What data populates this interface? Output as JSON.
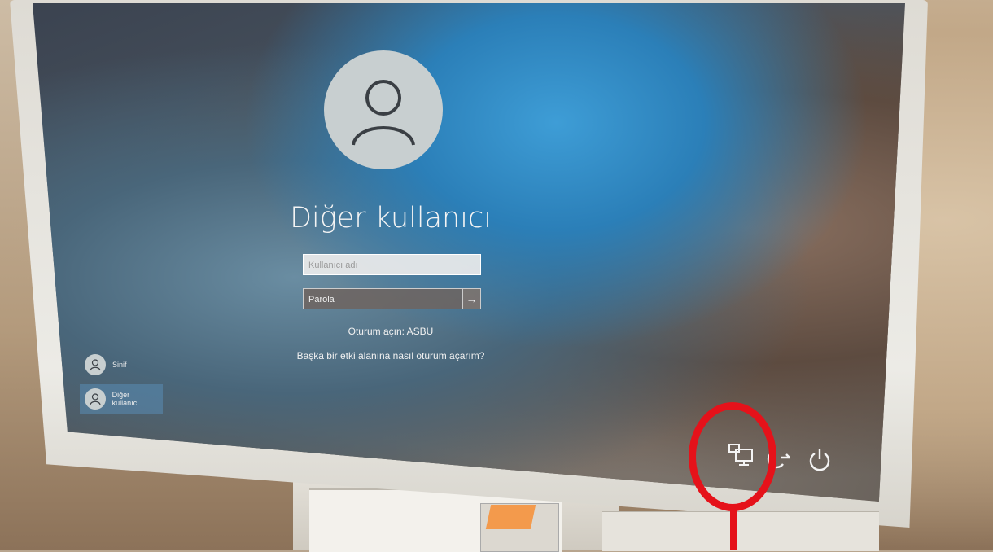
{
  "lock_screen": {
    "username": "Diğer kullanıcı",
    "username_placeholder": "Kullanıcı adı",
    "password_placeholder": "Parola",
    "sign_in_to": "Oturum açın: ASBU",
    "other_domain_link": "Başka bir etki alanına nasıl oturum açarım?"
  },
  "user_list": [
    {
      "name": "Sinif"
    },
    {
      "name": "Diğer kullanıcı"
    }
  ],
  "system_icons": [
    "network-icon",
    "ease-of-access-icon",
    "power-icon"
  ],
  "colors": {
    "annotation_ring": "#e5121a",
    "accent_blue": "#3e9dd6"
  }
}
